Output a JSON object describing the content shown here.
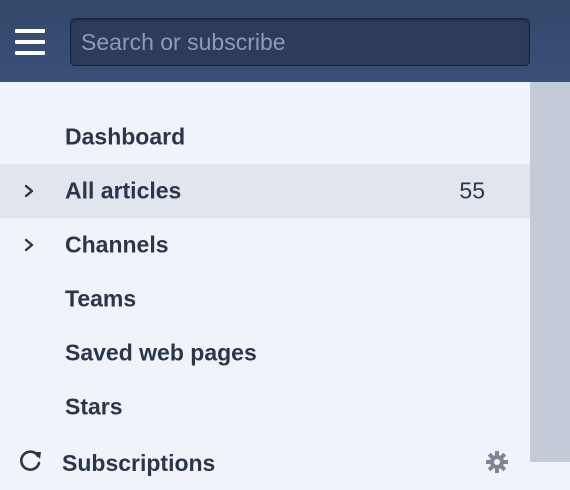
{
  "search": {
    "placeholder": "Search or subscribe"
  },
  "nav": {
    "dashboard": {
      "label": "Dashboard"
    },
    "all_articles": {
      "label": "All articles",
      "count": "55"
    },
    "channels": {
      "label": "Channels"
    },
    "teams": {
      "label": "Teams"
    },
    "saved_web_pages": {
      "label": "Saved web pages"
    },
    "stars": {
      "label": "Stars"
    },
    "subscriptions": {
      "label": "Subscriptions"
    }
  },
  "icons": {
    "menu": "hamburger-menu-icon",
    "expand": "chevron-right-icon",
    "refresh": "refresh-icon",
    "settings": "gear-icon"
  },
  "colors": {
    "topbar": "#34476a",
    "sidebar_bg": "#f0f4fa",
    "selected_bg": "#e1e6ee",
    "text": "#2b364a",
    "strip": "#c3cad8"
  }
}
